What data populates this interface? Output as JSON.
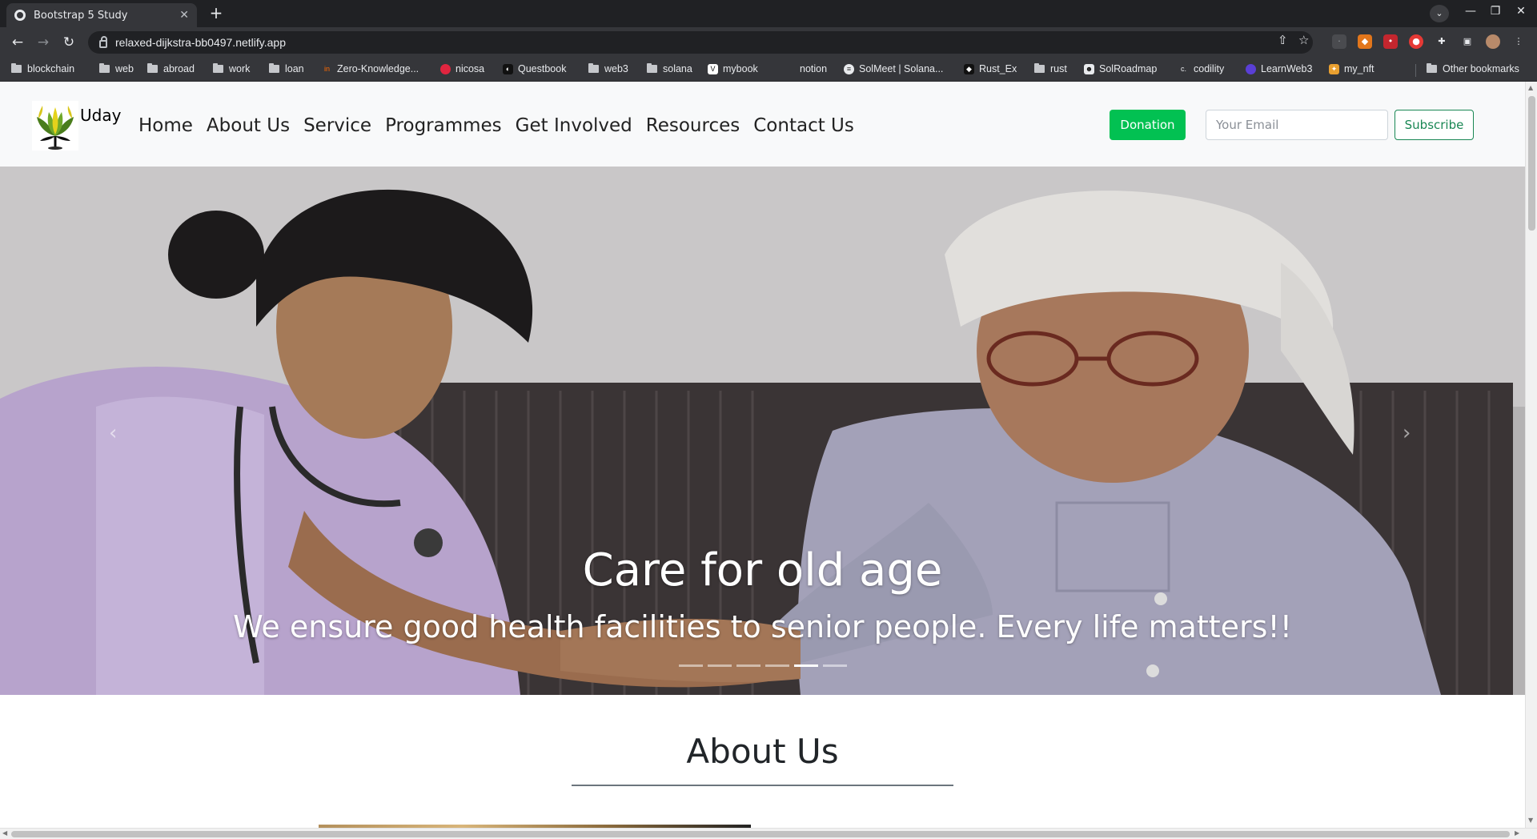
{
  "browser": {
    "tab_title": "Bootstrap 5 Study",
    "url": "relaxed-dijkstra-bb0497.netlify.app",
    "bookmarks": [
      {
        "label": "blockchain",
        "type": "folder"
      },
      {
        "label": "web",
        "type": "folder"
      },
      {
        "label": "abroad",
        "type": "folder"
      },
      {
        "label": "work",
        "type": "folder"
      },
      {
        "label": "loan",
        "type": "folder"
      },
      {
        "label": "Zero-Knowledge...",
        "type": "site"
      },
      {
        "label": "nicosa",
        "type": "site"
      },
      {
        "label": "Questbook",
        "type": "site"
      },
      {
        "label": "web3",
        "type": "folder"
      },
      {
        "label": "solana",
        "type": "folder"
      },
      {
        "label": "mybook",
        "type": "site"
      },
      {
        "label": "notion",
        "type": "site"
      },
      {
        "label": "SolMeet | Solana...",
        "type": "site"
      },
      {
        "label": "Rust_Ex",
        "type": "site"
      },
      {
        "label": "rust",
        "type": "folder"
      },
      {
        "label": "SolRoadmap",
        "type": "site"
      },
      {
        "label": "codility",
        "type": "site"
      },
      {
        "label": "LearnWeb3",
        "type": "site"
      },
      {
        "label": "my_nft",
        "type": "site"
      }
    ],
    "other_bookmarks": "Other bookmarks"
  },
  "site": {
    "brand": "Uday",
    "nav": [
      "Home",
      "About Us",
      "Service",
      "Programmes",
      "Get Involved",
      "Resources",
      "Contact Us"
    ],
    "donation_label": "Donation",
    "email_placeholder": "Your Email",
    "subscribe_label": "Subscribe"
  },
  "carousel": {
    "title": "Care for old age",
    "subtitle": "We ensure good health facilities to senior people. Every life matters!!",
    "slide_count": 6,
    "active_slide": 5
  },
  "about": {
    "title": "About Us"
  },
  "colors": {
    "donation": "#02c152",
    "subscribe": "#198754"
  }
}
